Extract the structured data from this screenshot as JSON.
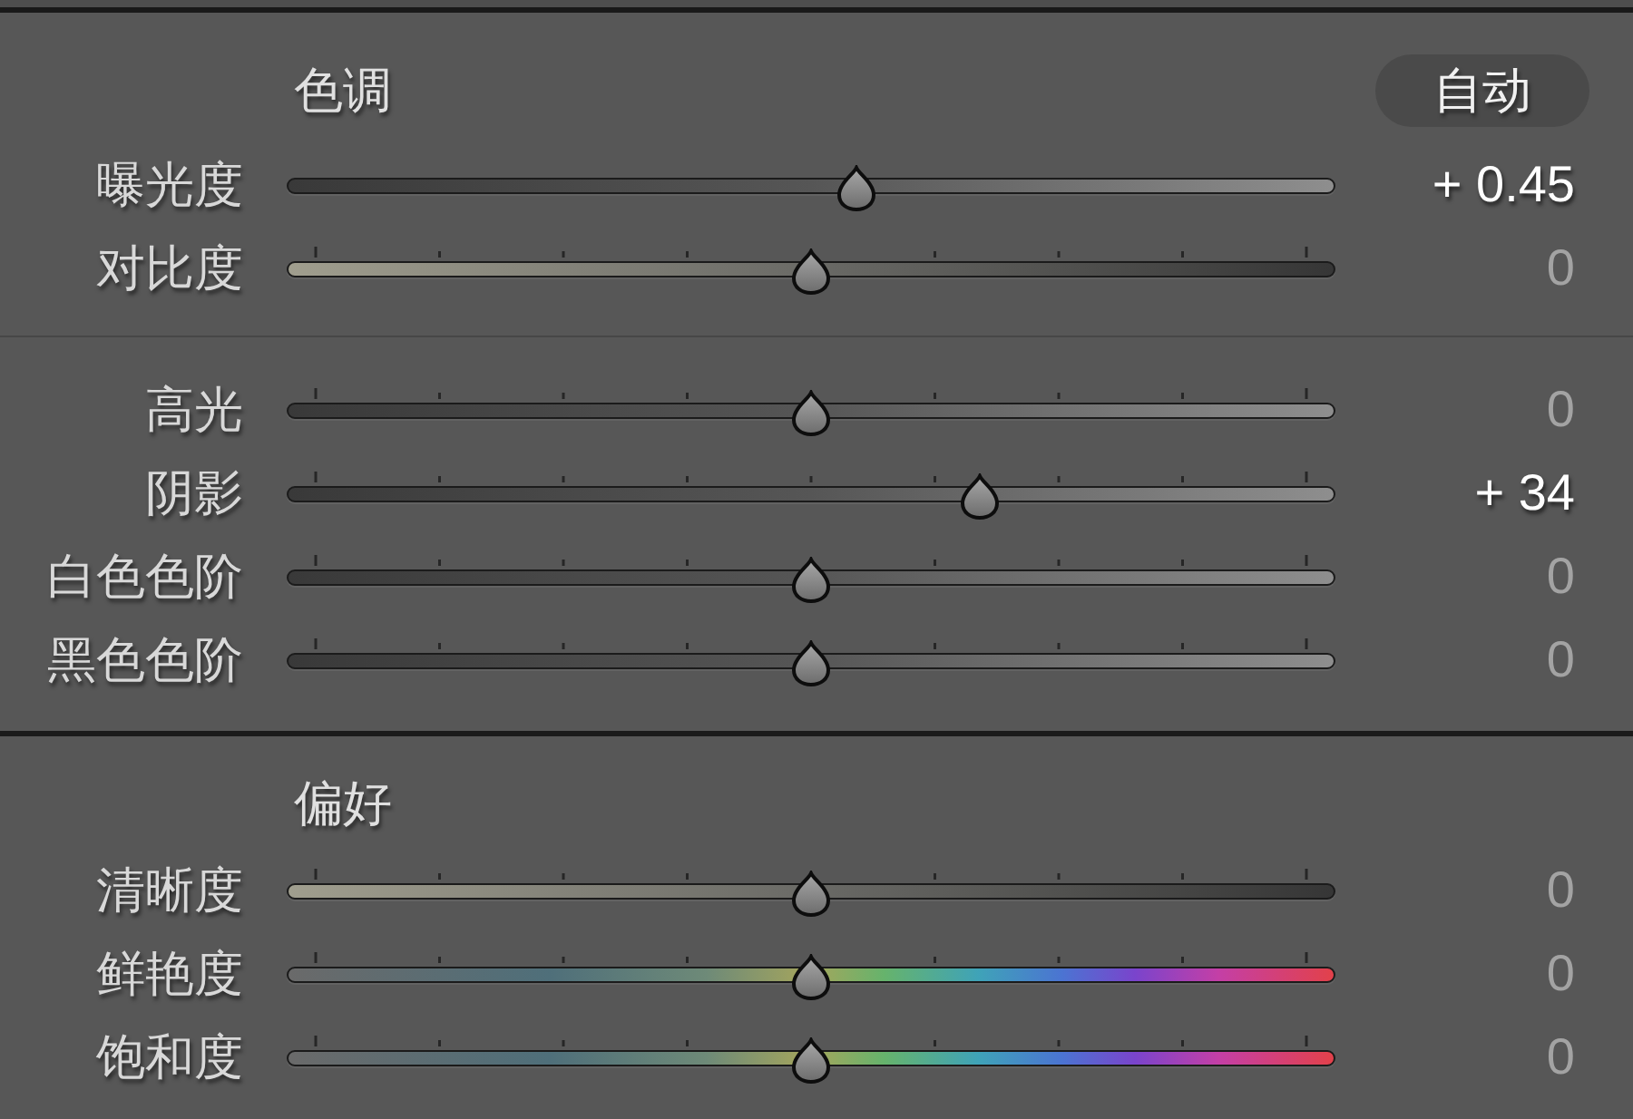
{
  "sections": [
    {
      "title": "色调",
      "auto_button": "自动",
      "groups": [
        {
          "sliders": [
            {
              "label": "曝光度",
              "kind": "rising",
              "ticks": false,
              "level": 0.545,
              "value": "+ 0.45",
              "modified": true
            },
            {
              "label": "对比度",
              "kind": "falling",
              "ticks": true,
              "level": 0.5,
              "value": "0",
              "modified": false
            }
          ]
        },
        {
          "sliders": [
            {
              "label": "高光",
              "kind": "rising",
              "ticks": true,
              "level": 0.5,
              "value": "0",
              "modified": false
            },
            {
              "label": "阴影",
              "kind": "rising",
              "ticks": true,
              "level": 0.67,
              "value": "+ 34",
              "modified": true
            },
            {
              "label": "白色色阶",
              "kind": "rising",
              "ticks": true,
              "level": 0.5,
              "value": "0",
              "modified": false
            },
            {
              "label": "黑色色阶",
              "kind": "rising",
              "ticks": true,
              "level": 0.5,
              "value": "0",
              "modified": false
            }
          ]
        }
      ]
    },
    {
      "title": "偏好",
      "groups": [
        {
          "sliders": [
            {
              "label": "清晰度",
              "kind": "falling",
              "ticks": true,
              "level": 0.5,
              "value": "0",
              "modified": false
            },
            {
              "label": "鲜艳度",
              "kind": "spectrum",
              "ticks": true,
              "level": 0.5,
              "value": "0",
              "modified": false
            },
            {
              "label": "饱和度",
              "kind": "spectrum",
              "ticks": true,
              "level": 0.5,
              "value": "0",
              "modified": false
            }
          ]
        }
      ]
    }
  ]
}
